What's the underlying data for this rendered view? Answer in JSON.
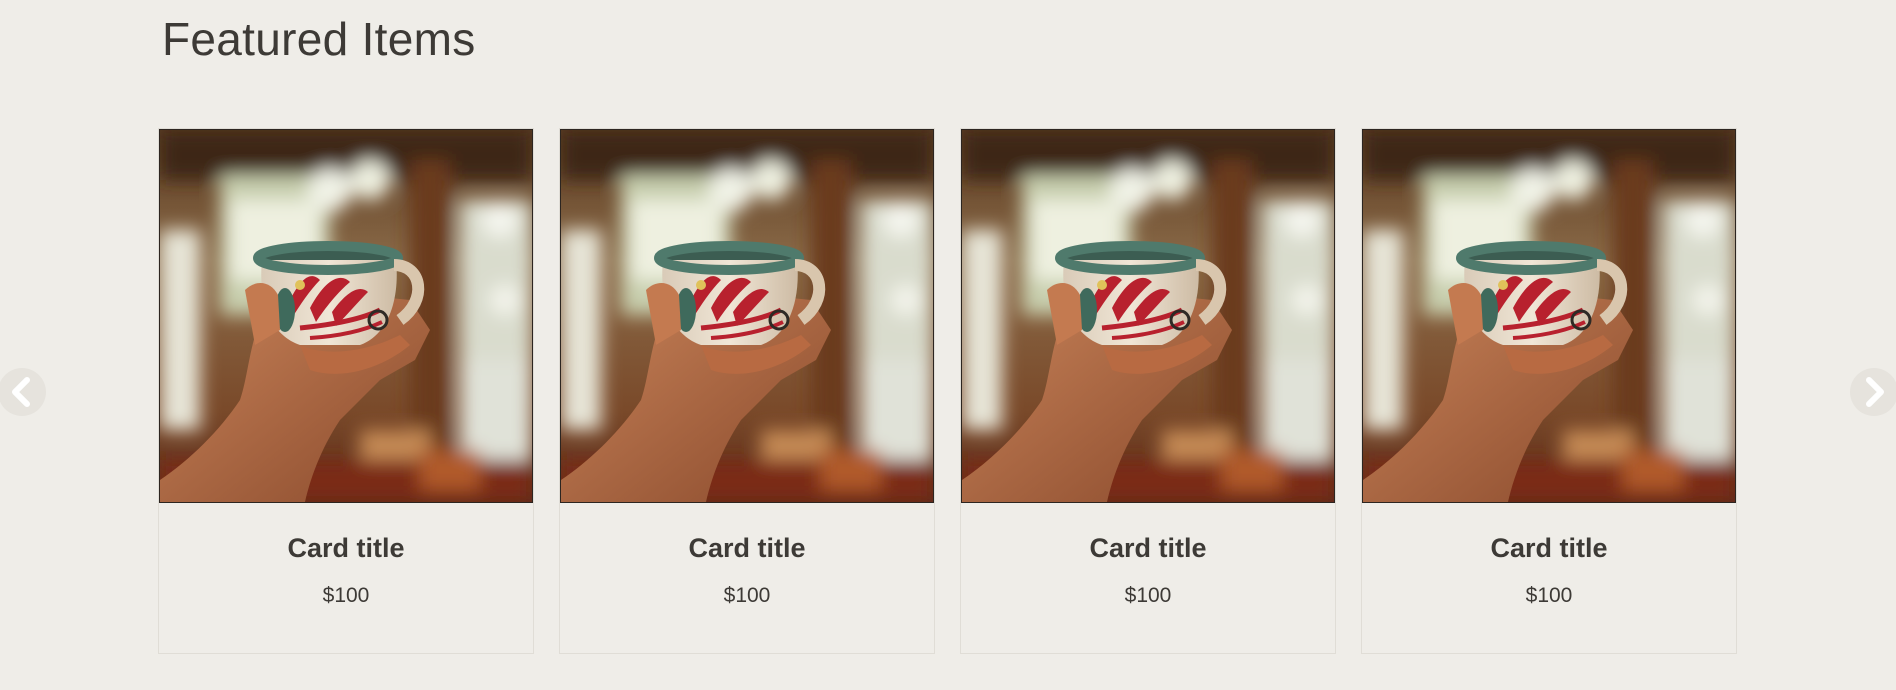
{
  "section": {
    "title": "Featured Items"
  },
  "carousel": {
    "prev_icon": "chevron-left-icon",
    "next_icon": "chevron-right-icon",
    "cards": [
      {
        "title": "Card title",
        "price": "$100",
        "image": "hand-holding-mug"
      },
      {
        "title": "Card title",
        "price": "$100",
        "image": "hand-holding-mug"
      },
      {
        "title": "Card title",
        "price": "$100",
        "image": "hand-holding-mug"
      },
      {
        "title": "Card title",
        "price": "$100",
        "image": "hand-holding-mug"
      }
    ]
  },
  "colors": {
    "background": "#efede8",
    "text": "#3d3a36",
    "mug_rim": "#4f7a6c",
    "mug_pattern": "#b8212e"
  }
}
